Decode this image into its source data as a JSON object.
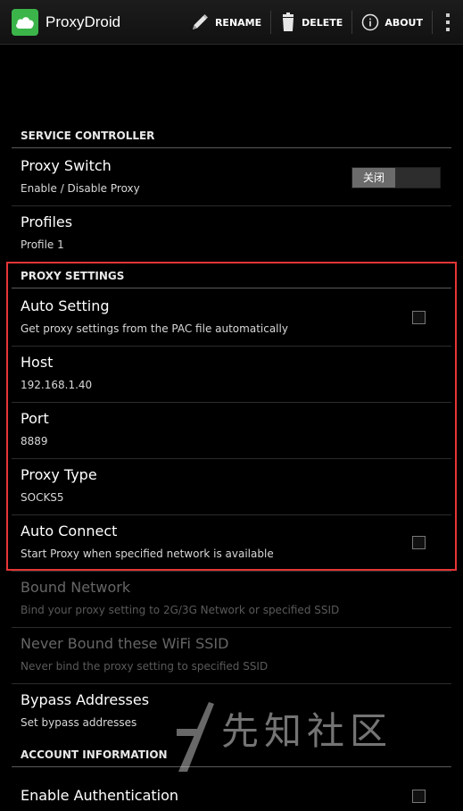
{
  "app": {
    "title": "ProxyDroid",
    "icon": "cloud-icon",
    "accent": "#3bb54a"
  },
  "actions": [
    {
      "icon": "pencil-icon",
      "label": "RENAME"
    },
    {
      "icon": "trash-icon",
      "label": "DELETE"
    },
    {
      "icon": "info-icon",
      "label": "ABOUT"
    }
  ],
  "sections": {
    "service": {
      "header": "SERVICE CONTROLLER",
      "proxy_switch": {
        "title": "Proxy Switch",
        "summary": "Enable / Disable Proxy",
        "toggle_label": "关闭"
      },
      "profiles": {
        "title": "Profiles",
        "summary": "Profile 1"
      }
    },
    "proxy": {
      "header": "PROXY SETTINGS",
      "auto_setting": {
        "title": "Auto Setting",
        "summary": "Get proxy settings from the PAC file automatically",
        "checked": false
      },
      "host": {
        "title": "Host",
        "summary": "192.168.1.40"
      },
      "port": {
        "title": "Port",
        "summary": "8889"
      },
      "proxy_type": {
        "title": "Proxy Type",
        "summary": "SOCKS5"
      },
      "auto_connect": {
        "title": "Auto Connect",
        "summary": "Start Proxy when specified network is available",
        "checked": false
      },
      "bound_network": {
        "title": "Bound Network",
        "summary": "Bind your proxy setting to 2G/3G Network or specified SSID",
        "enabled": false
      },
      "never_bound": {
        "title": "Never Bound these WiFi SSID",
        "summary": "Never bind the proxy setting to specified SSID",
        "enabled": false
      },
      "bypass": {
        "title": "Bypass Addresses",
        "summary": "Set bypass addresses"
      }
    },
    "account": {
      "header": "ACCOUNT INFORMATION",
      "enable_auth": {
        "title": "Enable Authentication",
        "checked": false
      }
    }
  },
  "watermark": {
    "text": "先知社区"
  },
  "colors": {
    "highlight": "#e53535",
    "background": "#000000"
  }
}
